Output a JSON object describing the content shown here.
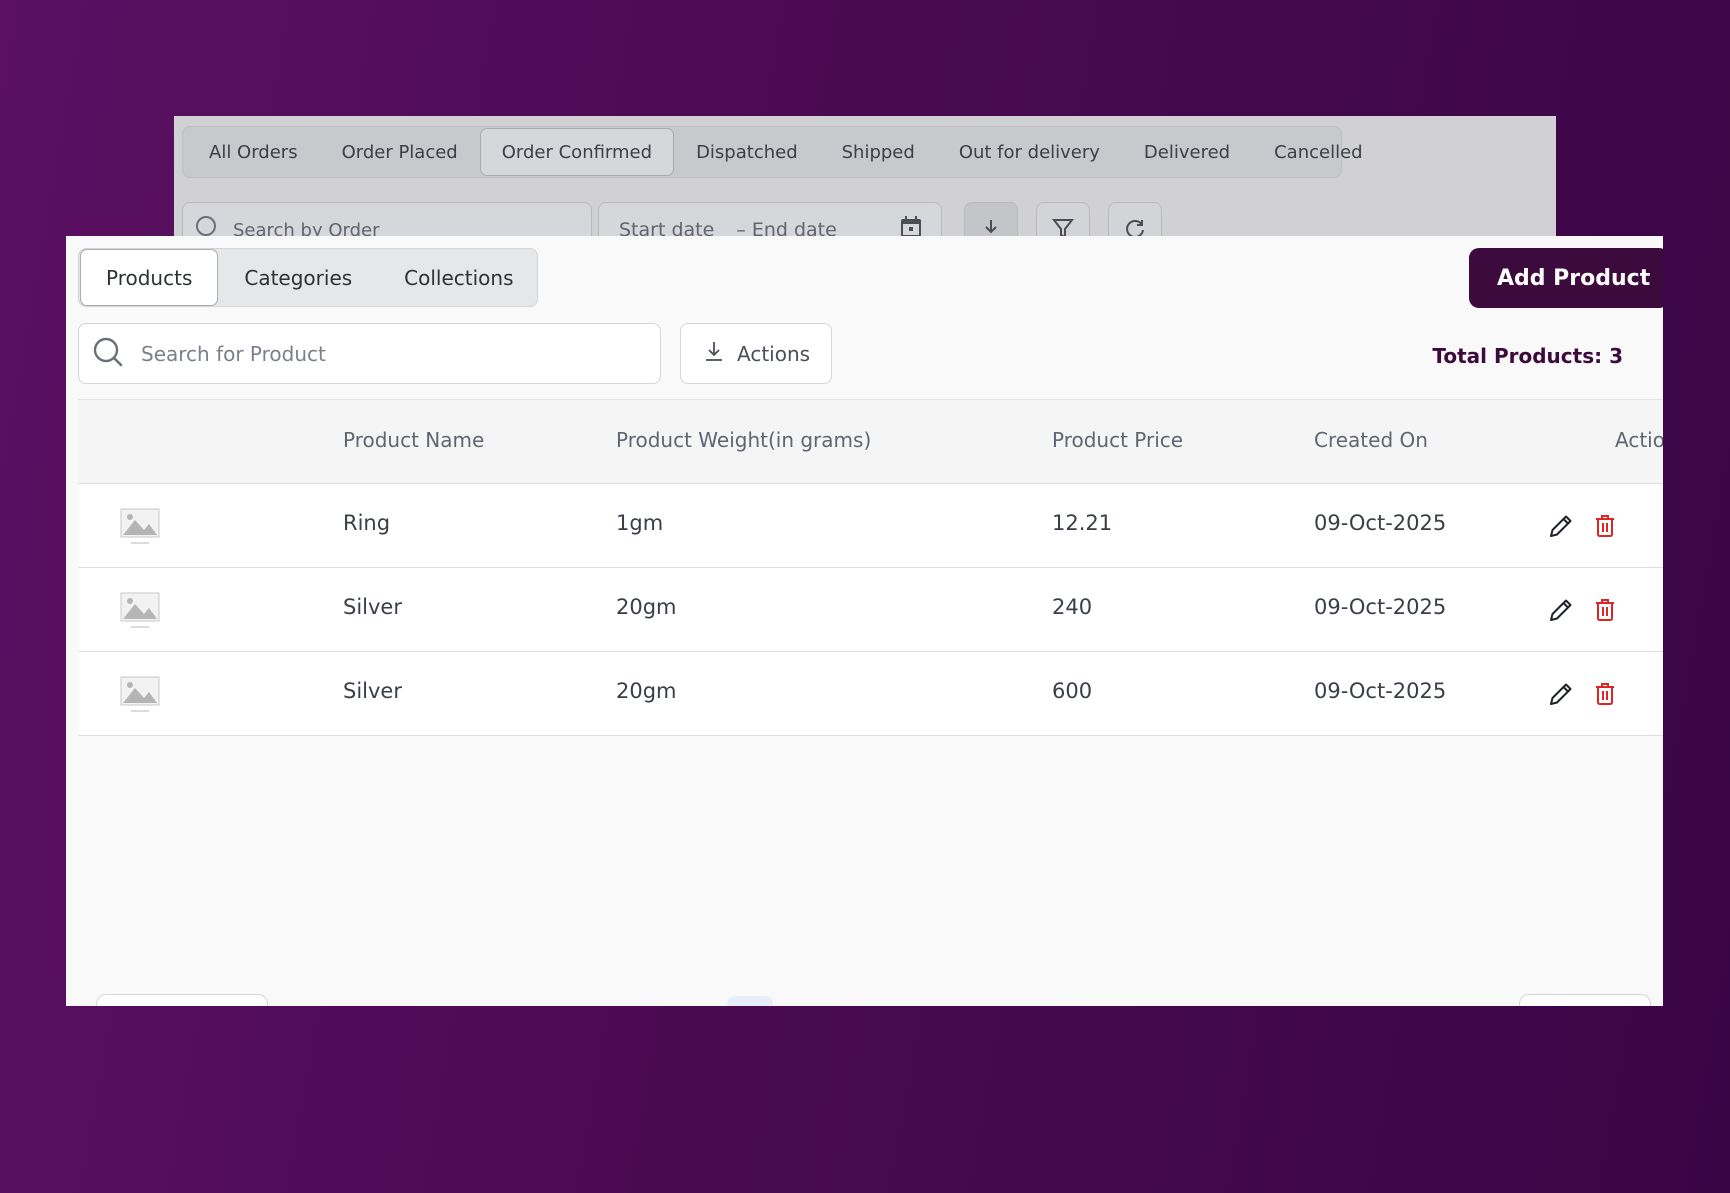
{
  "orders": {
    "tabs": [
      "All Orders",
      "Order Placed",
      "Order Confirmed",
      "Dispatched",
      "Shipped",
      "Out for delivery",
      "Delivered",
      "Cancelled"
    ],
    "active_tab": "Order Confirmed",
    "search_placeholder": "Search by Order",
    "start_date_placeholder": "Start date",
    "end_date_placeholder": "– End date"
  },
  "products": {
    "tabs": [
      "Products",
      "Categories",
      "Collections"
    ],
    "active_tab": "Products",
    "add_button_label": "Add Product",
    "search_placeholder": "Search for Product",
    "actions_label": "Actions",
    "total_label": "Total Products: 3",
    "columns": [
      "Product Name",
      "Product Weight(in grams)",
      "Product Price",
      "Created On",
      "Action"
    ],
    "rows": [
      {
        "name": "Ring",
        "weight": "1gm",
        "price": "12.21",
        "created": "09-Oct-2025"
      },
      {
        "name": "Silver",
        "weight": "20gm",
        "price": "240",
        "created": "09-Oct-2025"
      },
      {
        "name": "Silver",
        "weight": "20gm",
        "price": "600",
        "created": "09-Oct-2025"
      }
    ]
  },
  "colors": {
    "brand": "#3d0a3d",
    "delete": "#dc2626",
    "background": "#4a0a52"
  },
  "icons": [
    "search-icon",
    "calendar-icon",
    "download-icon",
    "filter-icon",
    "refresh-icon",
    "image-placeholder-icon",
    "edit-icon",
    "trash-icon"
  ]
}
